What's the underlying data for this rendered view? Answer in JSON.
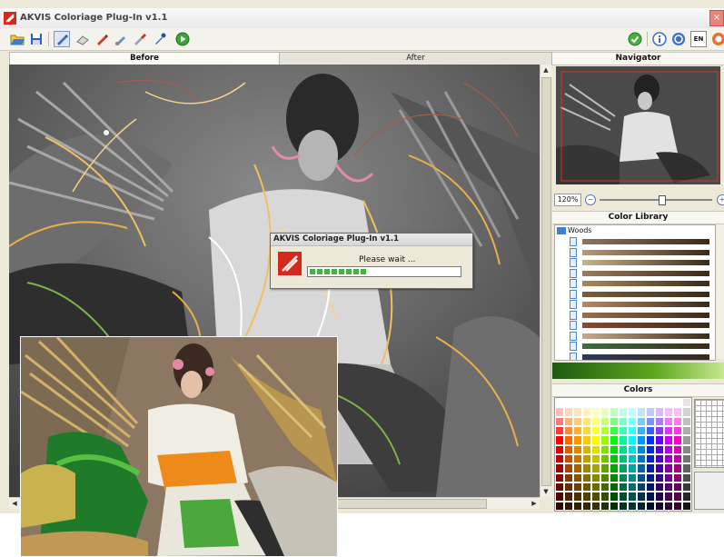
{
  "window": {
    "title": "AKVIS Coloriage Plug-In v1.1",
    "close_label": "×"
  },
  "toolbar": {
    "left_icons": [
      "open-folder-icon",
      "save-icon",
      "pencil-icon",
      "eraser-icon",
      "red-pencil-icon",
      "brush-icon",
      "chisel-icon",
      "eyedropper-icon",
      "run-icon"
    ],
    "right_icons": [
      "apply-check-icon",
      "info-icon",
      "help-icon",
      "settings-icon"
    ],
    "lang_label": "EN"
  },
  "tabs": {
    "before": "Before",
    "after": "After"
  },
  "dialog": {
    "title": "AKVIS Coloriage Plug-In v1.1",
    "message": "Please wait ...",
    "progress": 0.42
  },
  "right_panel": {
    "navigator_title": "Navigator",
    "zoom_value": "120%",
    "zoom_minus": "−",
    "zoom_plus": "+",
    "zoom_level": 0.55,
    "library_title": "Color Library",
    "library_folder": "Woods",
    "library_swatches": [
      "#8a7560",
      "#b79a76",
      "#c8b390",
      "#9c7c5d",
      "#a88a5a",
      "#7c5e3b",
      "#b68863",
      "#9b6e4a",
      "#8a4a2e",
      "#c9a98a",
      "#3c6e3c",
      "#2a3a55"
    ],
    "colors_title": "Colors"
  },
  "palette_colors": {
    "hues": [
      "#ff0000",
      "#ff6600",
      "#ff9900",
      "#ffcc00",
      "#ffff00",
      "#99ff00",
      "#00ff00",
      "#00ff99",
      "#00ffff",
      "#0099ff",
      "#0033ff",
      "#6600ff",
      "#cc00ff",
      "#ff00cc",
      "#888888"
    ]
  },
  "colors": {
    "accent_red": "#d42a1b",
    "progress_green": "#3cb83c"
  }
}
